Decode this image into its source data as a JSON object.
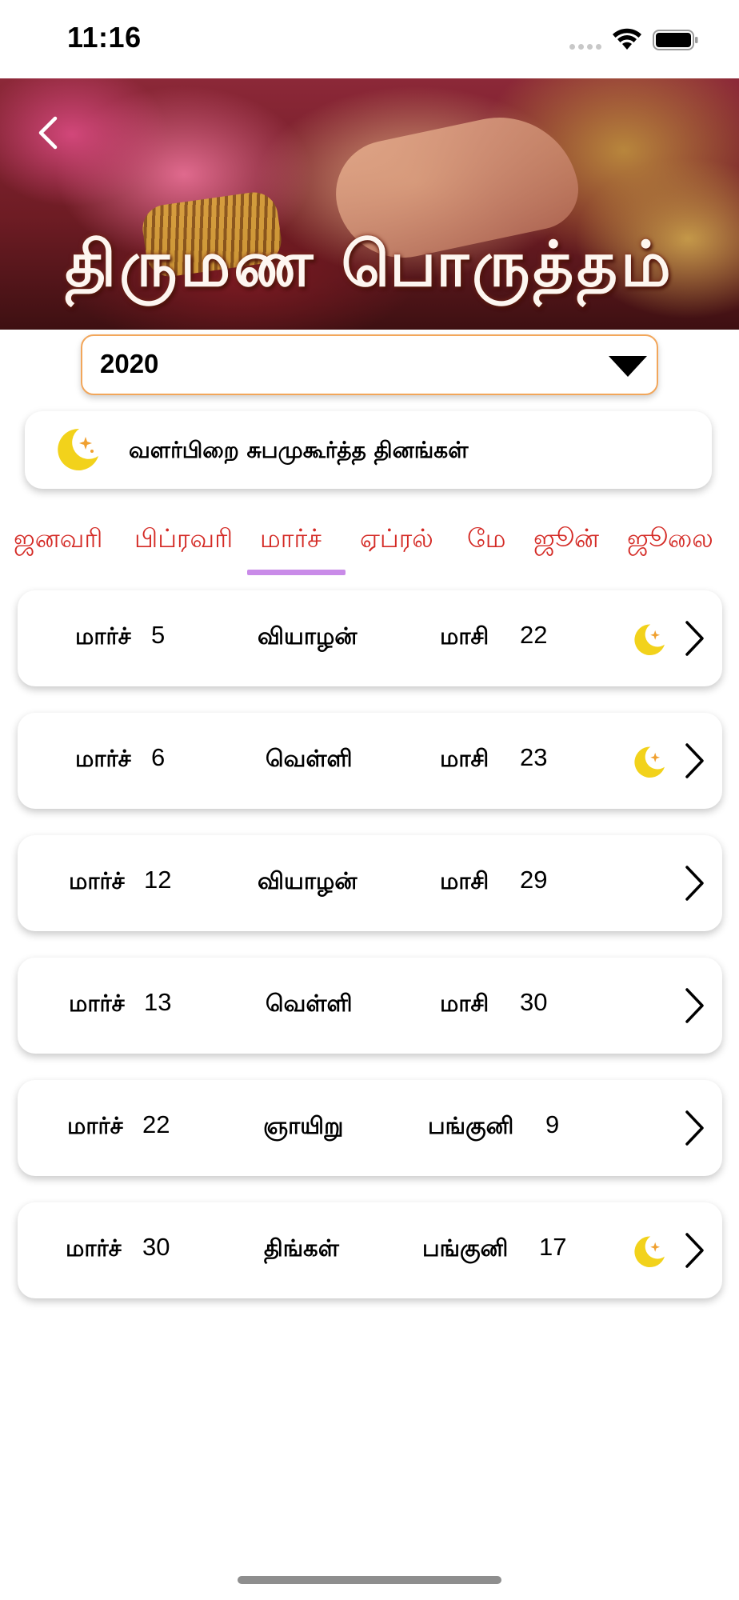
{
  "status_bar": {
    "time": "11:16"
  },
  "banner": {
    "title": "திருமண பொருத்தம்"
  },
  "year_select": {
    "value": "2020"
  },
  "info_card": {
    "icon": "crescent-moon-icon",
    "text": "வளர்பிறை சுபமுகூர்த்த தினங்கள்"
  },
  "months": {
    "selected": "மார்ச்",
    "items": [
      {
        "label": "ஜனவரி"
      },
      {
        "label": "பிப்ரவரி"
      },
      {
        "label": "மார்ச்"
      },
      {
        "label": "ஏப்ரல்"
      },
      {
        "label": "மே"
      },
      {
        "label": "ஜூன்"
      },
      {
        "label": "ஜூலை"
      }
    ]
  },
  "dates": [
    {
      "month": "மார்ச்",
      "day": "5",
      "weekday": "வியாழன்",
      "tamil_month": "மாசி",
      "tamil_day": "22",
      "moon": true
    },
    {
      "month": "மார்ச்",
      "day": "6",
      "weekday": "வெள்ளி",
      "tamil_month": "மாசி",
      "tamil_day": "23",
      "moon": true
    },
    {
      "month": "மார்ச்",
      "day": "12",
      "weekday": "வியாழன்",
      "tamil_month": "மாசி",
      "tamil_day": "29",
      "moon": false
    },
    {
      "month": "மார்ச்",
      "day": "13",
      "weekday": "வெள்ளி",
      "tamil_month": "மாசி",
      "tamil_day": "30",
      "moon": false
    },
    {
      "month": "மார்ச்",
      "day": "22",
      "weekday": "ஞாயிறு",
      "tamil_month": "பங்குனி",
      "tamil_day": "9",
      "moon": false
    },
    {
      "month": "மார்ச்",
      "day": "30",
      "weekday": "திங்கள்",
      "tamil_month": "பங்குனி",
      "tamil_day": "17",
      "moon": true
    }
  ],
  "colors": {
    "accent_red": "#d42a25",
    "tab_underline": "#c98be8",
    "dropdown_border": "#f2a65a",
    "moon": "#f2d21b"
  }
}
